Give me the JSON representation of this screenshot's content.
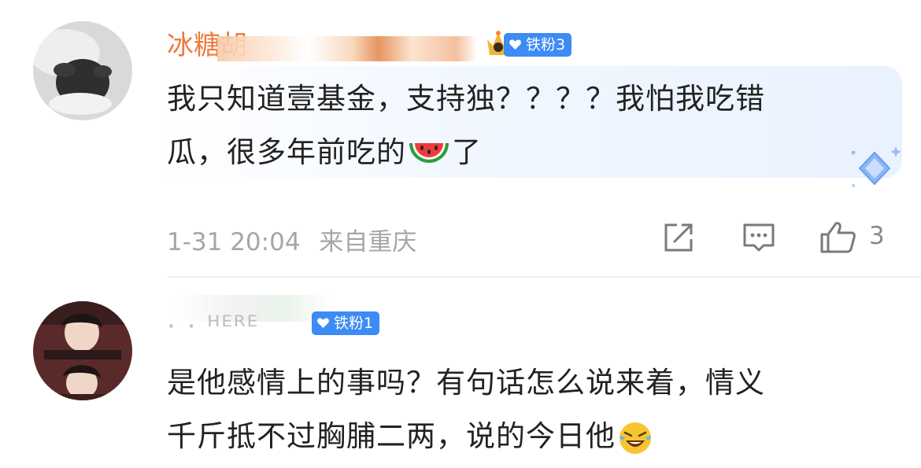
{
  "comments": [
    {
      "username": "冰糖胡",
      "badge": "铁粉3",
      "text_line1": "我只知道壹基金，支持独？？？？我怕我吃错",
      "text_line2_a": "瓜，很多年前吃的",
      "text_line2_b": "了",
      "date": "1-31 20:04",
      "location": "来自重庆",
      "like_count": "3"
    },
    {
      "username": "·  ·  ᴴᴱᴿᴱ",
      "badge": "铁粉1",
      "text_line1": "是他感情上的事吗？有句话怎么说来着，情义",
      "text_line2": "千斤抵不过胸脯二两，说的今日他"
    }
  ],
  "colors": {
    "username_vip": "#ee7a3c",
    "badge_bg": "#3d8bf4",
    "meta_text": "#a6a6a6",
    "body_text": "#222222"
  },
  "icons": [
    "share-icon",
    "comment-icon",
    "thumbs-up-icon",
    "watermelon-emoji",
    "laughing-emoji",
    "crown-icon",
    "diamond-icon"
  ]
}
